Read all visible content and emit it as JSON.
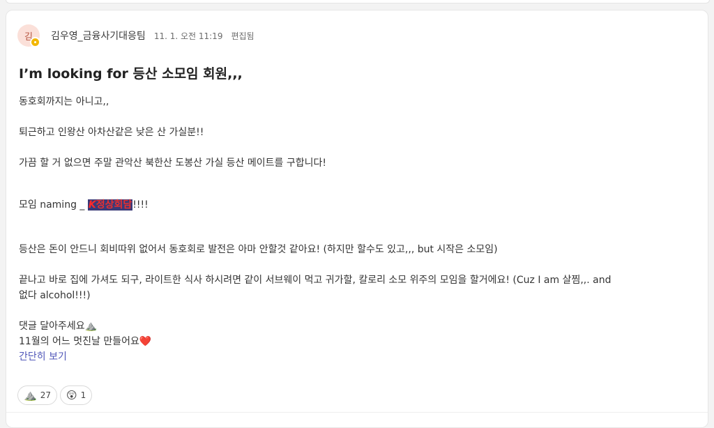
{
  "post": {
    "author_initial": "김",
    "author": "김우영_금융사기대응팀",
    "time": "11. 1. 오전 11:19",
    "edited": "편집됨",
    "title": "I’m looking for 등산 소모임 회원,,,",
    "lines": {
      "l1": "동호회까지는 아니고,,",
      "l2": "퇴근하고 인왕산 아차산같은 낮은 산 가실분!!",
      "l3": "가끔 할 거 없으면 주말 관악산 북한산 도봉산 가실 등산 메이트를 구합니다!",
      "l4_prefix": "모임 naming _ ",
      "l4_k": "K",
      "l4_highlight": "정상회담",
      "l4_suffix": "!!!!",
      "l5": "등산은 돈이 안드니 회비따위 없어서 동호회로 발전은 아마 안할것 같아요! (하지만 할수도 있고,,, but 시작은 소모임)",
      "l6a": "끝나고 바로 집에 가셔도 되구, 라이트한 식사 하시려면 같이 서브웨이 먹고 귀가할, 칼로리 소모 위주의 모임을 할거에요! (Cuz I am 살찜,,. and",
      "l6b": "없다 alcohol!!!)",
      "l7": "댓글 달아주세요",
      "l7_emoji": "⛰️",
      "l8": "11월의 어느 멋진날 만들어요",
      "l8_emoji": "❤️"
    },
    "collapse_link": "간단히 보기"
  },
  "reactions": [
    {
      "icon": "mountain-emoji",
      "glyph": "⛰️",
      "count": "27"
    },
    {
      "icon": "astonished-face-emoji",
      "glyph": "😲",
      "count": "1"
    }
  ],
  "colors": {
    "highlight_bg": "#3b3a78",
    "highlight_text": "#e83030",
    "link": "#4f56b8",
    "avatar_bg": "#fbe0d9",
    "badge": "#f2b705"
  }
}
